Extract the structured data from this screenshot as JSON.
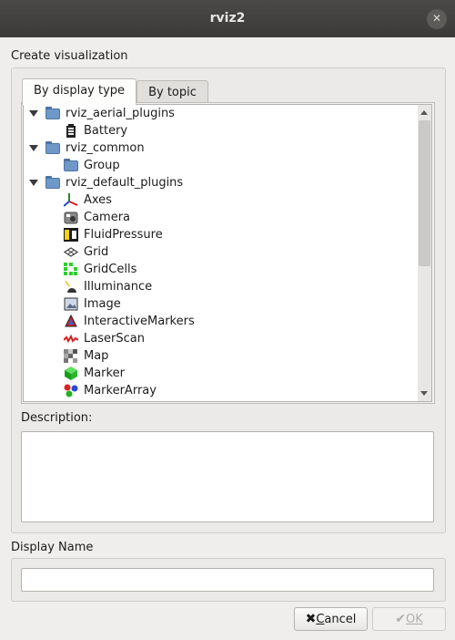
{
  "window": {
    "title": "rviz2",
    "close_glyph": "✕"
  },
  "section_title": "Create visualization",
  "tabs": [
    {
      "label": "By display type",
      "active": true
    },
    {
      "label": "By topic",
      "active": false
    }
  ],
  "tree": [
    {
      "label": "rviz_aerial_plugins",
      "kind": "folder",
      "expanded": true
    },
    {
      "label": "Battery",
      "kind": "item",
      "icon": "battery-icon"
    },
    {
      "label": "rviz_common",
      "kind": "folder",
      "expanded": true
    },
    {
      "label": "Group",
      "kind": "item",
      "icon": "folder-icon"
    },
    {
      "label": "rviz_default_plugins",
      "kind": "folder",
      "expanded": true
    },
    {
      "label": "Axes",
      "kind": "item",
      "icon": "axes-icon"
    },
    {
      "label": "Camera",
      "kind": "item",
      "icon": "camera-icon"
    },
    {
      "label": "FluidPressure",
      "kind": "item",
      "icon": "fluid-pressure-icon"
    },
    {
      "label": "Grid",
      "kind": "item",
      "icon": "grid-icon"
    },
    {
      "label": "GridCells",
      "kind": "item",
      "icon": "grid-cells-icon"
    },
    {
      "label": "Illuminance",
      "kind": "item",
      "icon": "illuminance-icon"
    },
    {
      "label": "Image",
      "kind": "item",
      "icon": "image-icon"
    },
    {
      "label": "InteractiveMarkers",
      "kind": "item",
      "icon": "interactive-markers-icon"
    },
    {
      "label": "LaserScan",
      "kind": "item",
      "icon": "laser-scan-icon"
    },
    {
      "label": "Map",
      "kind": "item",
      "icon": "map-icon"
    },
    {
      "label": "Marker",
      "kind": "item",
      "icon": "marker-icon"
    },
    {
      "label": "MarkerArray",
      "kind": "item",
      "icon": "marker-array-icon"
    }
  ],
  "description": {
    "label": "Description:",
    "value": ""
  },
  "display_name": {
    "label": "Display Name",
    "value": ""
  },
  "buttons": {
    "cancel": {
      "label": "Cancel",
      "mnemonic": "C",
      "rest": "ancel",
      "icon": "cancel-x-icon"
    },
    "ok": {
      "label": "OK",
      "enabled": false,
      "icon": "check-icon"
    }
  },
  "colors": {
    "titlebar": "#3b3a38",
    "background": "#efeeed",
    "folder": "#6f98c8"
  }
}
